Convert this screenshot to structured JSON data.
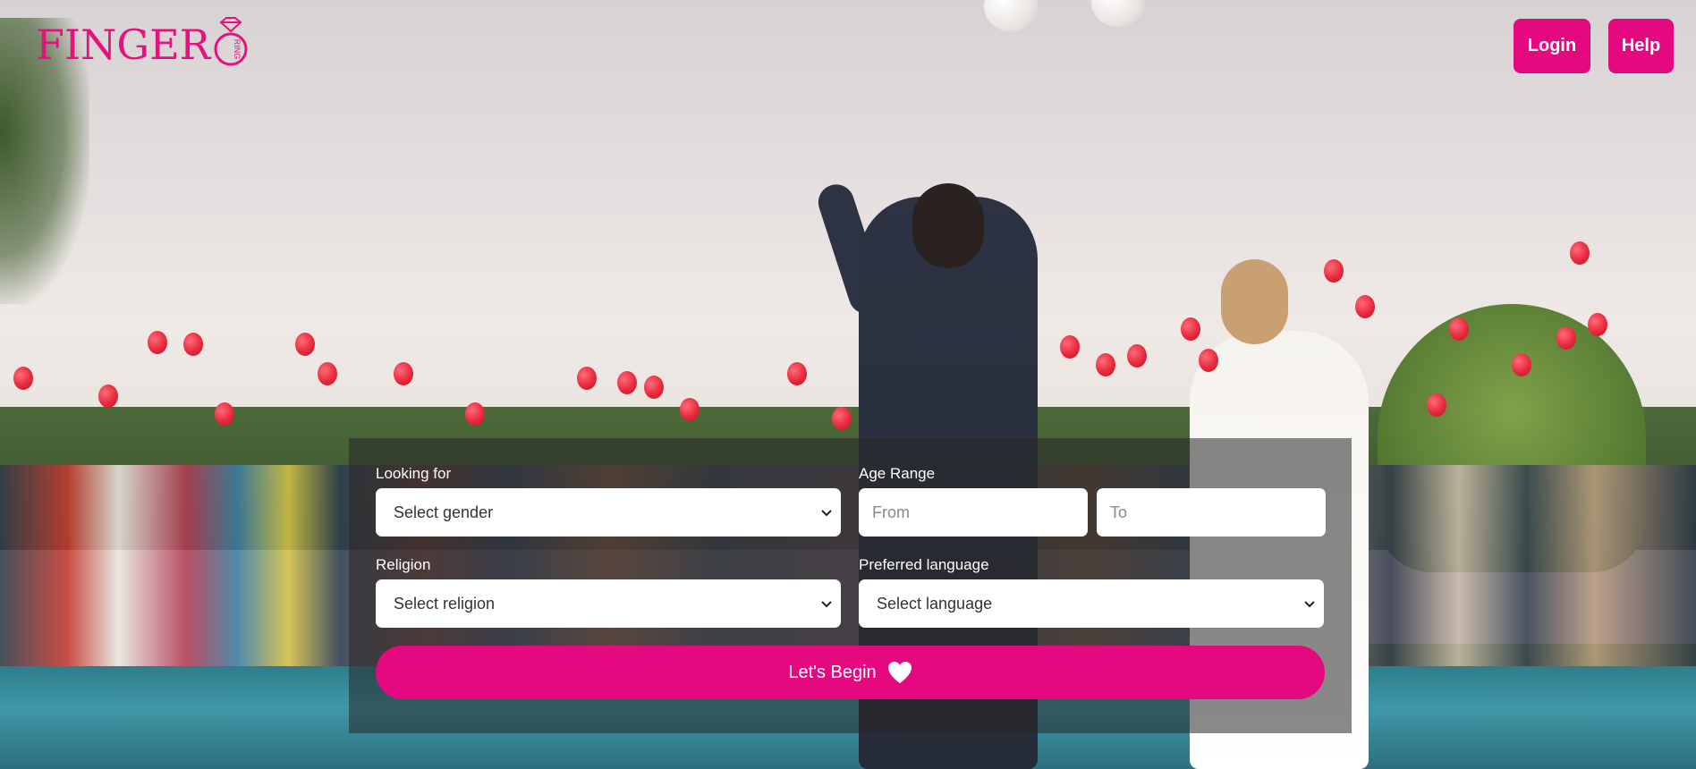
{
  "brand": {
    "name": "FINGER",
    "ring_text": "RING",
    "accent_color": "#e5097f"
  },
  "nav": {
    "login_label": "Login",
    "help_label": "Help"
  },
  "search": {
    "looking_for": {
      "label": "Looking for",
      "value": "Select gender"
    },
    "age_range": {
      "label": "Age Range",
      "from_placeholder": "From",
      "to_placeholder": "To"
    },
    "religion": {
      "label": "Religion",
      "value": "Select religion"
    },
    "language": {
      "label": "Preferred language",
      "value": "Select language"
    },
    "submit_label": "Let's Begin",
    "submit_icon": "heart-icon"
  }
}
